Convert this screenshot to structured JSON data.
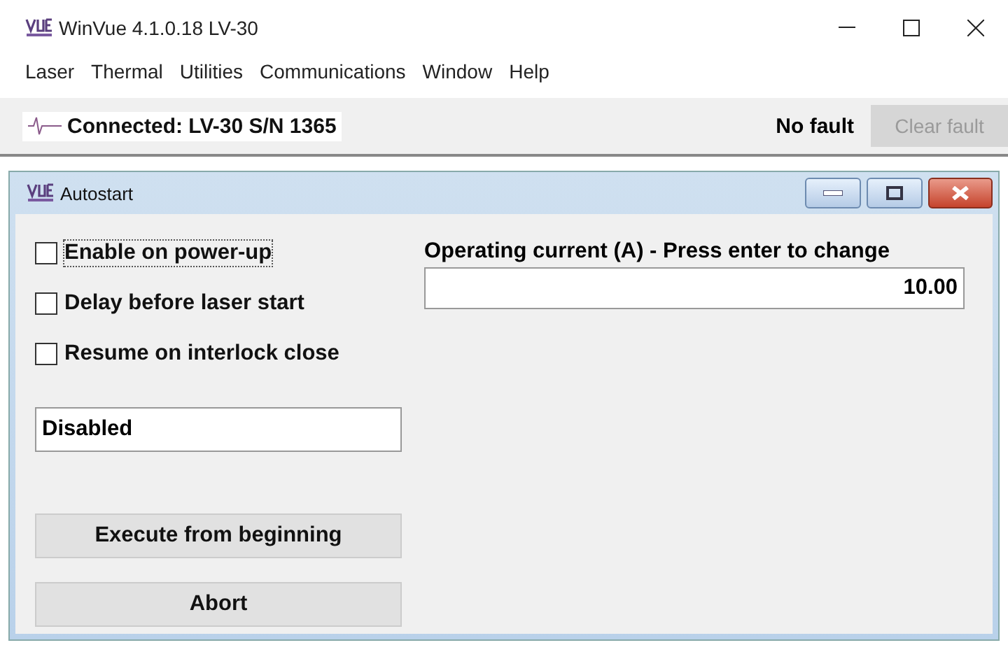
{
  "window": {
    "title": "WinVue 4.1.0.18 LV-30"
  },
  "menu": [
    "Laser",
    "Thermal",
    "Utilities",
    "Communications",
    "Window",
    "Help"
  ],
  "status_bar": {
    "connection": "Connected: LV-30 S/N 1365",
    "fault": "No fault",
    "clear_button": {
      "label": "Clear fault",
      "disabled": true
    }
  },
  "child_window": {
    "title": "Autostart",
    "checkboxes": [
      {
        "label": "Enable on power-up",
        "checked": false,
        "focused": true
      },
      {
        "label": "Delay before laser start",
        "checked": false,
        "focused": false
      },
      {
        "label": "Resume on interlock close",
        "checked": false,
        "focused": false
      }
    ],
    "status_field": {
      "value": "Disabled"
    },
    "buttons": [
      "Execute from beginning",
      "Abort"
    ],
    "current": {
      "label": "Operating current (A) - Press enter to change",
      "value": "10.00"
    }
  }
}
